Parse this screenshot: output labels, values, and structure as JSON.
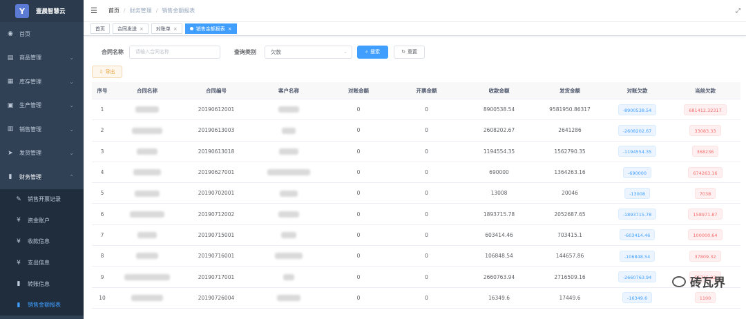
{
  "app": {
    "logo_text": "Y",
    "title": "壹晨智慧云"
  },
  "sidebar": {
    "items": [
      {
        "label": "首页",
        "icon": "dashboard-icon"
      },
      {
        "label": "商品管理",
        "icon": "goods-icon"
      },
      {
        "label": "库存管理",
        "icon": "inventory-icon"
      },
      {
        "label": "生产管理",
        "icon": "production-icon"
      },
      {
        "label": "销售管理",
        "icon": "sales-icon"
      },
      {
        "label": "发货管理",
        "icon": "shipping-icon"
      },
      {
        "label": "财务管理",
        "icon": "finance-icon"
      }
    ],
    "sub_items": [
      {
        "label": "销售开票记录",
        "icon": "edit-icon"
      },
      {
        "label": "资金账户",
        "icon": "yen-icon"
      },
      {
        "label": "收款信息",
        "icon": "yen-icon"
      },
      {
        "label": "支出信息",
        "icon": "yen-icon"
      },
      {
        "label": "转账信息",
        "icon": "book-icon"
      },
      {
        "label": "销售金额报表",
        "icon": "chart-icon"
      }
    ]
  },
  "header": {
    "breadcrumb": [
      "首页",
      "财务管理",
      "销售金额报表"
    ]
  },
  "tags": [
    {
      "label": "首页"
    },
    {
      "label": "合同发送"
    },
    {
      "label": "对账单"
    },
    {
      "label": "销售金额报表"
    }
  ],
  "search": {
    "contract_label": "合同名称",
    "contract_placeholder": "请输入合同名称",
    "type_label": "查询类别",
    "type_value": "欠款",
    "search_button": "搜索",
    "reset_button": "重置"
  },
  "toolbar": {
    "export_button": "导出"
  },
  "table": {
    "headers": [
      "序号",
      "合同名称",
      "合同编号",
      "客户名称",
      "对账金额",
      "开票金额",
      "收款金额",
      "发货金额",
      "对账欠款",
      "当前欠款"
    ],
    "rows": [
      {
        "idx": "1",
        "code": "20190612001",
        "dz": "0",
        "kp": "0",
        "sk": "8900538.54",
        "fh": "9581950.86317",
        "qk": "-8900538.54",
        "cur": "681412.32317"
      },
      {
        "idx": "2",
        "code": "20190613003",
        "dz": "0",
        "kp": "0",
        "sk": "2608202.67",
        "fh": "2641286",
        "qk": "-2608202.67",
        "cur": "33083.33"
      },
      {
        "idx": "3",
        "code": "20190613018",
        "dz": "0",
        "kp": "0",
        "sk": "1194554.35",
        "fh": "1562790.35",
        "qk": "-1194554.35",
        "cur": "368236"
      },
      {
        "idx": "4",
        "code": "20190627001",
        "dz": "0",
        "kp": "0",
        "sk": "690000",
        "fh": "1364263.16",
        "qk": "-690000",
        "cur": "674263.16"
      },
      {
        "idx": "5",
        "code": "20190702001",
        "dz": "0",
        "kp": "0",
        "sk": "13008",
        "fh": "20046",
        "qk": "-13008",
        "cur": "7038"
      },
      {
        "idx": "6",
        "code": "20190712002",
        "dz": "0",
        "kp": "0",
        "sk": "1893715.78",
        "fh": "2052687.65",
        "qk": "-1893715.78",
        "cur": "158971.87"
      },
      {
        "idx": "7",
        "code": "20190715001",
        "dz": "0",
        "kp": "0",
        "sk": "603414.46",
        "fh": "703415.1",
        "qk": "-603414.46",
        "cur": "100000.64"
      },
      {
        "idx": "8",
        "code": "20190716001",
        "dz": "0",
        "kp": "0",
        "sk": "106848.54",
        "fh": "144657.86",
        "qk": "-106848.54",
        "cur": "37809.32"
      },
      {
        "idx": "9",
        "code": "20190717001",
        "dz": "0",
        "kp": "0",
        "sk": "2660763.94",
        "fh": "2716509.16",
        "qk": "-2660763.94",
        "cur": "55745.22"
      },
      {
        "idx": "10",
        "code": "20190726004",
        "dz": "0",
        "kp": "0",
        "sk": "16349.6",
        "fh": "17449.6",
        "qk": "-16349.6",
        "cur": "1100"
      }
    ]
  },
  "watermark": {
    "text": "砖瓦界"
  }
}
